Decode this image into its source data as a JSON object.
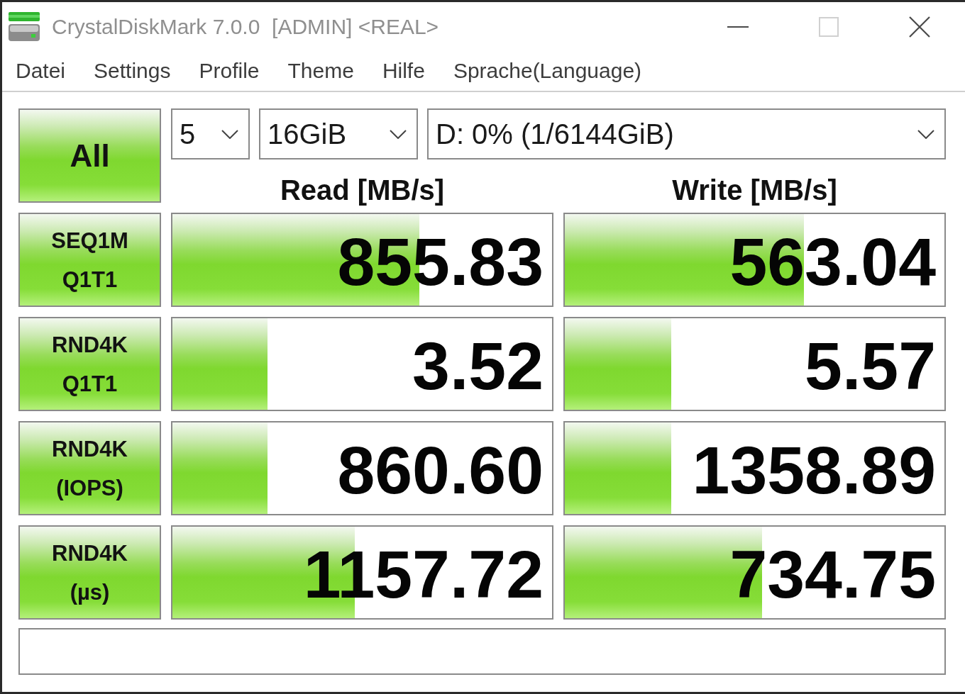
{
  "window": {
    "title": "CrystalDiskMark 7.0.0  [ADMIN] <REAL>",
    "controls": [
      {
        "kind": "minimize",
        "disabled": false
      },
      {
        "kind": "maximize",
        "disabled": true
      },
      {
        "kind": "close",
        "disabled": false
      }
    ]
  },
  "menu": [
    "Datei",
    "Settings",
    "Profile",
    "Theme",
    "Hilfe",
    "Sprache(Language)"
  ],
  "all_button": {
    "label": "All"
  },
  "selectors": [
    {
      "value": "5"
    },
    {
      "value": "16GiB"
    },
    {
      "value": "D: 0% (1/6144GiB)"
    }
  ],
  "columns": [
    "Read [MB/s]",
    "Write [MB/s]"
  ],
  "rows": [
    {
      "label": [
        "SEQ1M",
        "Q1T1"
      ],
      "read": {
        "value": "855.83",
        "level": 0.65
      },
      "write": {
        "value": "563.04",
        "level": 0.63
      }
    },
    {
      "label": [
        "RND4K",
        "Q1T1"
      ],
      "read": {
        "value": "3.52",
        "level": 0.25
      },
      "write": {
        "value": "5.57",
        "level": 0.28
      }
    },
    {
      "label": [
        "RND4K",
        "(IOPS)"
      ],
      "read": {
        "value": "860.60",
        "level": 0.25
      },
      "write": {
        "value": "1358.89",
        "level": 0.28
      }
    },
    {
      "label": [
        "RND4K",
        "(µs)"
      ],
      "read": {
        "value": "1157.72",
        "level": 0.48
      },
      "write": {
        "value": "734.75",
        "level": 0.52
      }
    }
  ]
}
